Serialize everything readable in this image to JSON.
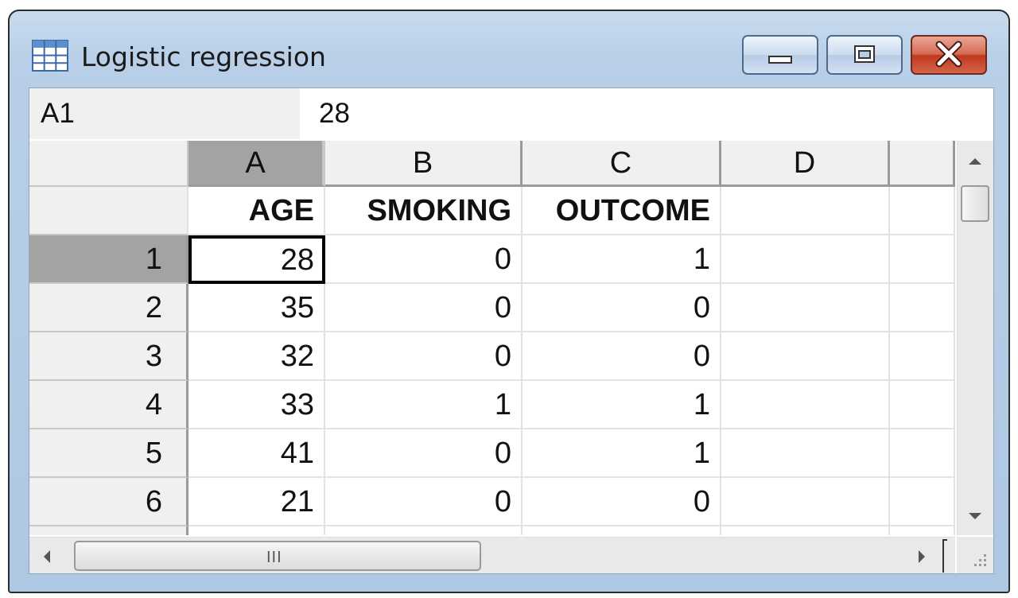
{
  "window": {
    "title": "Logistic regression",
    "app_icon": "spreadsheet-grid-icon",
    "controls": [
      "minimize-icon",
      "maximize-icon",
      "close-icon"
    ]
  },
  "formula_bar": {
    "cell_ref": "A1",
    "value": "28"
  },
  "columns": [
    "A",
    "B",
    "C",
    "D"
  ],
  "variable_labels": [
    "AGE",
    "SMOKING",
    "OUTCOME"
  ],
  "rows": [
    {
      "num": "1",
      "cells": [
        "28",
        "0",
        "1"
      ]
    },
    {
      "num": "2",
      "cells": [
        "35",
        "0",
        "0"
      ]
    },
    {
      "num": "3",
      "cells": [
        "32",
        "0",
        "0"
      ]
    },
    {
      "num": "4",
      "cells": [
        "33",
        "1",
        "1"
      ]
    },
    {
      "num": "5",
      "cells": [
        "41",
        "0",
        "1"
      ]
    },
    {
      "num": "6",
      "cells": [
        "21",
        "0",
        "0"
      ]
    }
  ],
  "selection": {
    "column": "A",
    "row": "1"
  },
  "scrollbars": {
    "horizontal_grip": "III"
  },
  "colors": {
    "title_bar": "#b8cfe7",
    "header_bg": "#f0f0f0",
    "selected_header_bg": "#a3a3a3",
    "close_button": "#c0391c",
    "grid_line": "#e2e2e2"
  }
}
